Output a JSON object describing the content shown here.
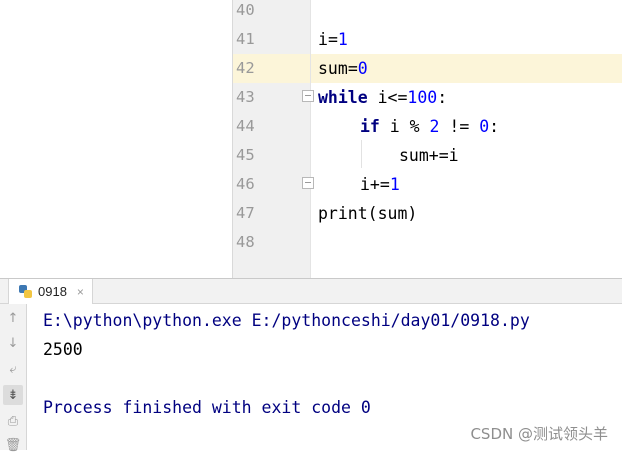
{
  "editor": {
    "line_numbers": [
      "40",
      "41",
      "42",
      "43",
      "44",
      "45",
      "46",
      "47",
      "48"
    ],
    "current_line": "42",
    "code": {
      "l41": [
        "i",
        "=",
        "1"
      ],
      "l42": [
        "sum",
        "=",
        "0"
      ],
      "l43": [
        "while",
        " i<=",
        "100",
        ":"
      ],
      "l44": [
        "if",
        " i % ",
        "2",
        " != ",
        "0",
        ":"
      ],
      "l45": [
        "sum+=i"
      ],
      "l46": [
        "i+=",
        "1"
      ],
      "l47": [
        "print(sum)"
      ]
    }
  },
  "run_panel": {
    "tab_label": "0918",
    "tab_icon": "python-icon",
    "close_label": "×",
    "toolbar_icons": [
      "arrow-up-icon",
      "arrow-down-icon",
      "soft-wrap-icon",
      "scroll-to-end-icon",
      "print-icon",
      "trash-icon"
    ],
    "console_lines": {
      "command": "E:\\python\\python.exe E:/pythonceshi/day01/0918.py",
      "output": "2500",
      "finished": "Process finished with exit code 0"
    }
  },
  "watermark": "CSDN @测试领头羊",
  "colors": {
    "keyword": "#000080",
    "number": "#0000ff",
    "current_line_bg": "#fcf5d9",
    "console_system_text": "#000080"
  }
}
